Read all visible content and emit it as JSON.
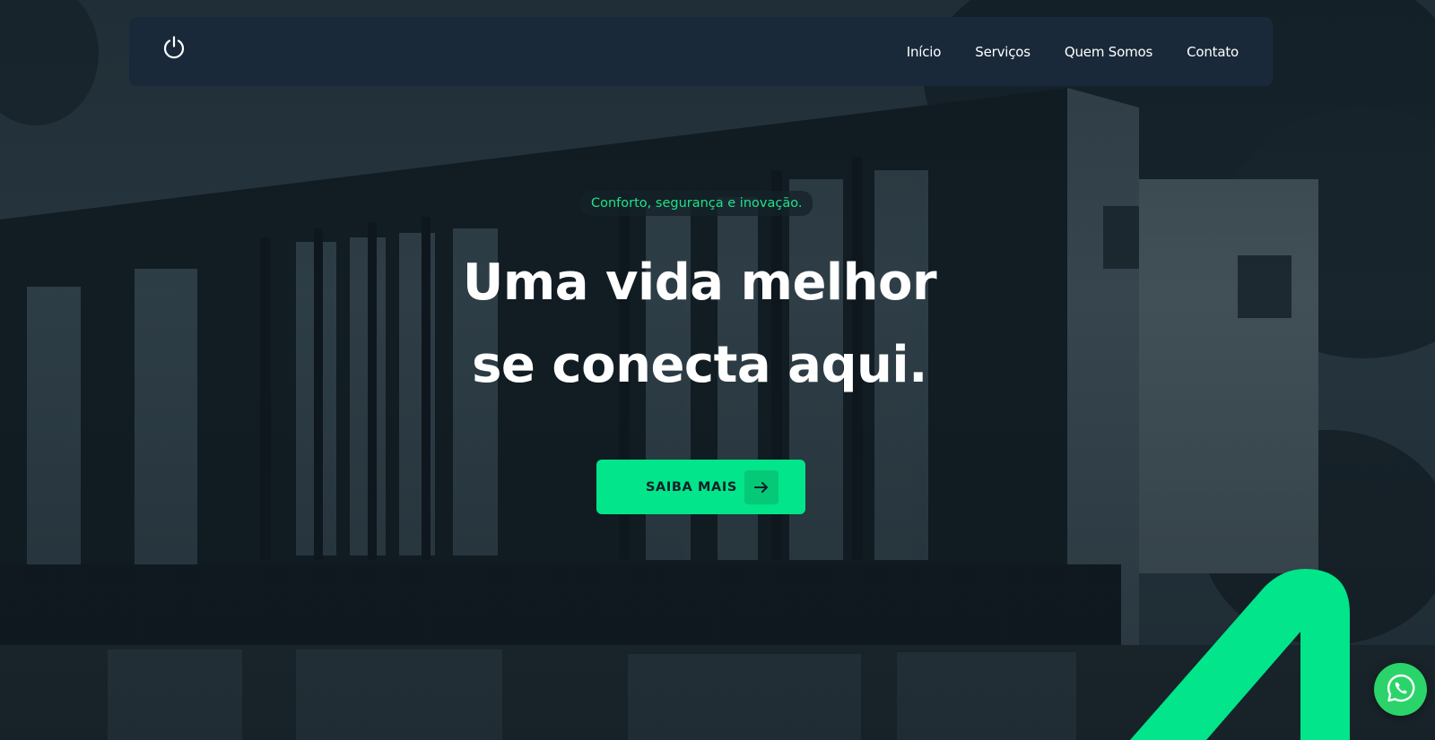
{
  "navbar": {
    "logo_icon": "power-icon",
    "links": [
      {
        "label": "Início"
      },
      {
        "label": "Serviços"
      },
      {
        "label": "Quem Somos"
      },
      {
        "label": "Contato"
      }
    ]
  },
  "hero": {
    "tagline": "Conforto, segurança e inovação.",
    "headline_line1": "Uma vida melhor",
    "headline_line2": "se conecta aqui.",
    "cta_label": "SAIBA MAIS",
    "cta_icon": "arrow-right-icon"
  },
  "floating": {
    "whatsapp_icon": "whatsapp-icon"
  },
  "colors": {
    "accent": "#02e58a",
    "navbar_bg": "#19293a",
    "tagline_text": "#1fe38a",
    "whatsapp": "#2bd46a"
  }
}
